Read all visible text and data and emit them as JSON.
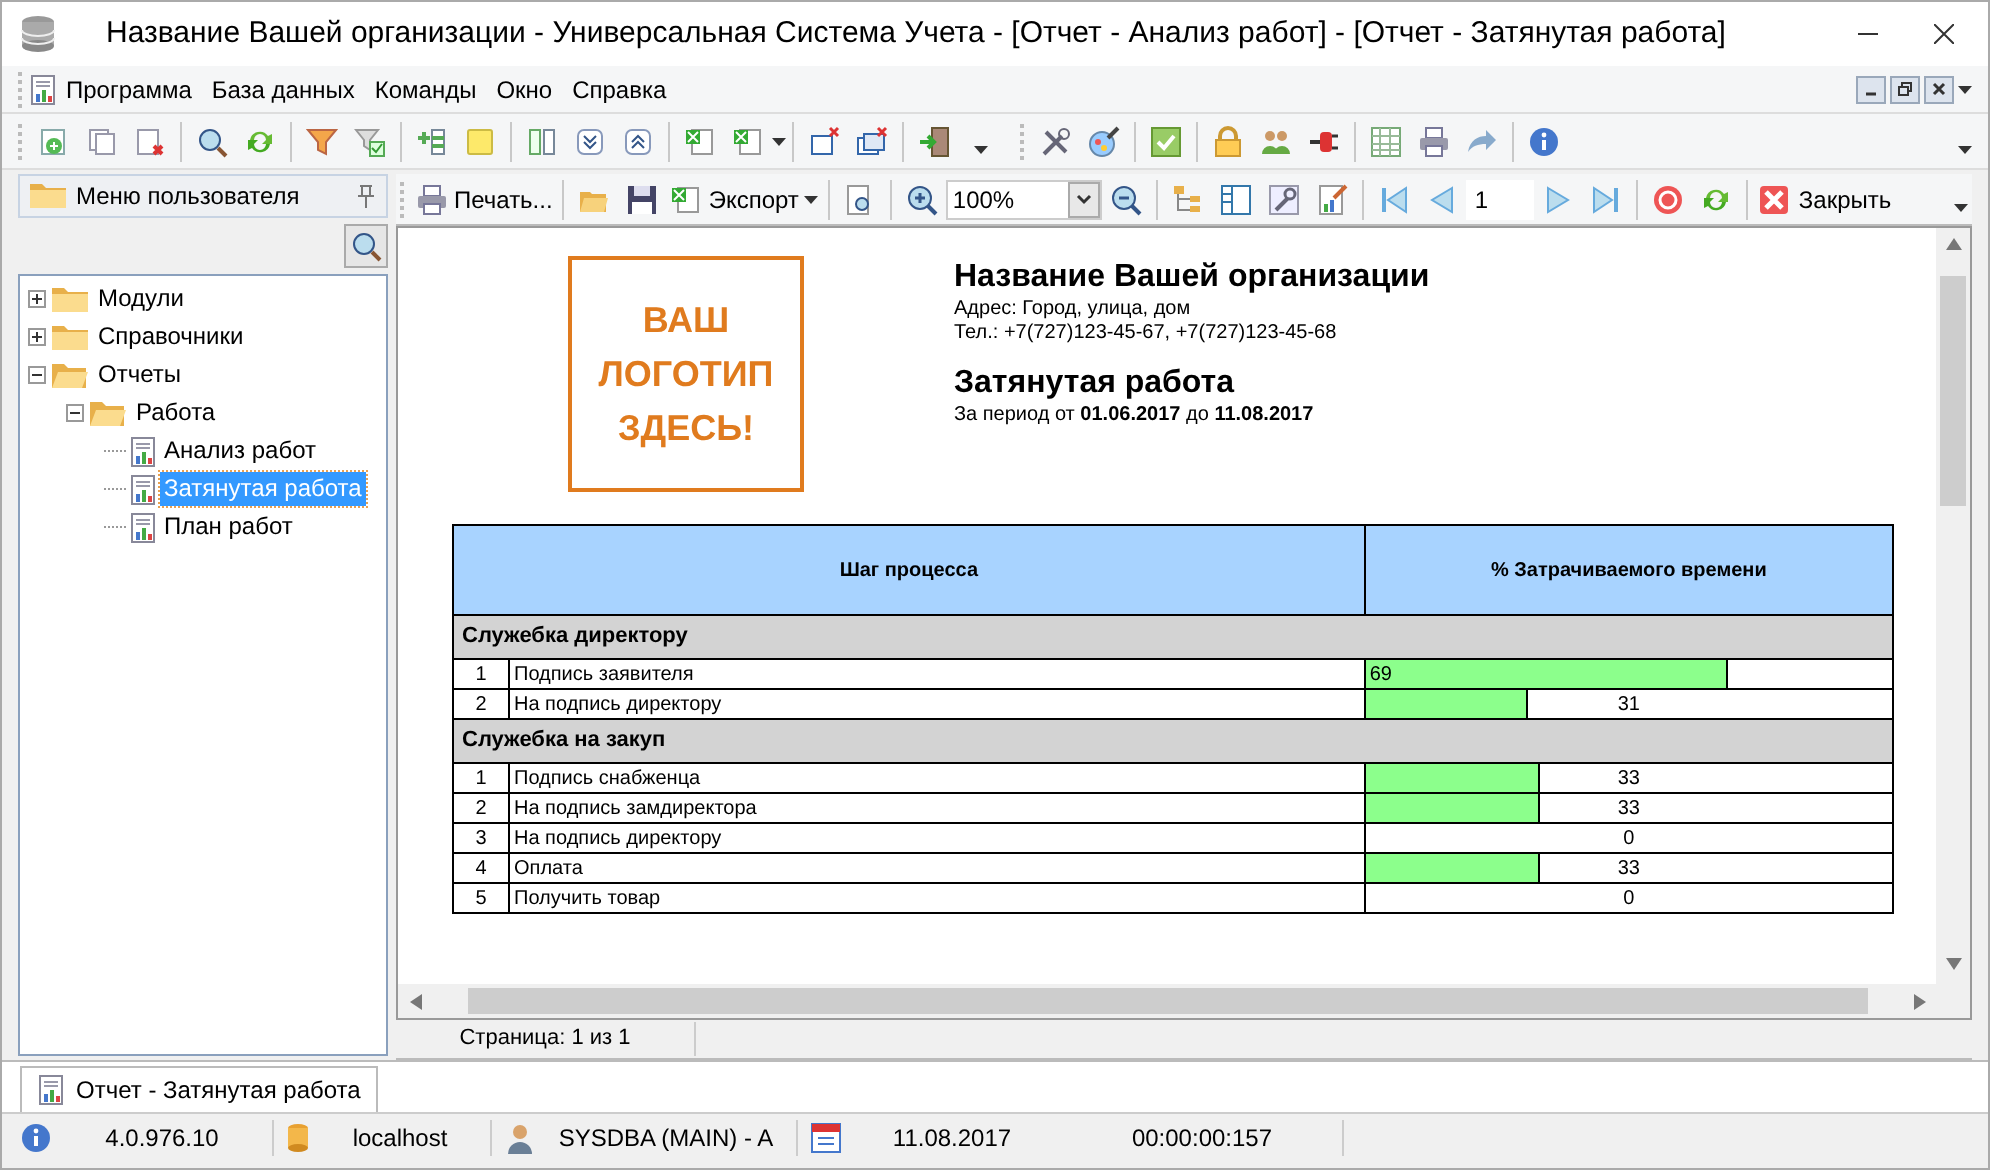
{
  "window": {
    "title": "Название Вашей организации - Универсальная Система Учета - [Отчет - Анализ работ] - [Отчет - Затянутая работа]"
  },
  "menu": [
    "Программа",
    "База данных",
    "Команды",
    "Окно",
    "Справка"
  ],
  "sidebar": {
    "title": "Меню пользователя",
    "tree": [
      {
        "label": "Модули",
        "kind": "folder",
        "expanded": false,
        "selected": false
      },
      {
        "label": "Справочники",
        "kind": "folder",
        "expanded": false,
        "selected": false
      },
      {
        "label": "Отчеты",
        "kind": "folder",
        "expanded": true,
        "selected": false,
        "children": [
          {
            "label": "Работа",
            "kind": "folder",
            "expanded": true,
            "selected": false,
            "children": [
              {
                "label": "Анализ работ",
                "kind": "report",
                "selected": false
              },
              {
                "label": "Затянутая работа",
                "kind": "report",
                "selected": true
              },
              {
                "label": "План работ",
                "kind": "report",
                "selected": false
              }
            ]
          }
        ]
      }
    ]
  },
  "report_toolbar": {
    "print": "Печать...",
    "export": "Экспорт",
    "zoom": "100%",
    "page": "1",
    "close": "Закрыть"
  },
  "report": {
    "logo": [
      "ВАШ",
      "ЛОГОТИП",
      "ЗДЕСЬ!"
    ],
    "org_name": "Название Вашей организации",
    "address": "Адрес: Город, улица, дом",
    "phone": "Тел.: +7(727)123-45-67, +7(727)123-45-68",
    "title": "Затянутая работа",
    "period": "За период от **01.06.2017** до **11.08.2017**",
    "table": {
      "columns": [
        "Шаг процесса",
        "% Затрачиваемого времени"
      ],
      "groups": [
        {
          "name": "Служебка директору",
          "rows": [
            {
              "num": "1",
              "step": "Подпись заявителя",
              "value": "69",
              "level": 0.69
            },
            {
              "num": "2",
              "step": "На подпись директору",
              "value": "31",
              "level": 0.31
            }
          ]
        },
        {
          "name": "Служебка на закуп",
          "rows": [
            {
              "num": "1",
              "step": "Подпись снабженца",
              "value": "33",
              "level": 0.33
            },
            {
              "num": "2",
              "step": "На подпись замдиректора",
              "value": "33",
              "level": 0.33
            },
            {
              "num": "3",
              "step": "На подпись директору",
              "value": "0"
            },
            {
              "num": "4",
              "step": "Оплата",
              "value": "33",
              "level": 0.33
            },
            {
              "num": "5",
              "step": "Получить товар",
              "value": "0"
            }
          ]
        }
      ]
    }
  },
  "page_status": "Страница: 1 из 1",
  "tabs": [
    {
      "label": "Отчет - Затянутая работа",
      "selected": true
    }
  ],
  "status_bar": {
    "version": "4.0.976.10",
    "server": "localhost",
    "user": "SYSDBA (MAIN) - A",
    "date": "11.08.2017",
    "time": "00:00:00:157"
  }
}
